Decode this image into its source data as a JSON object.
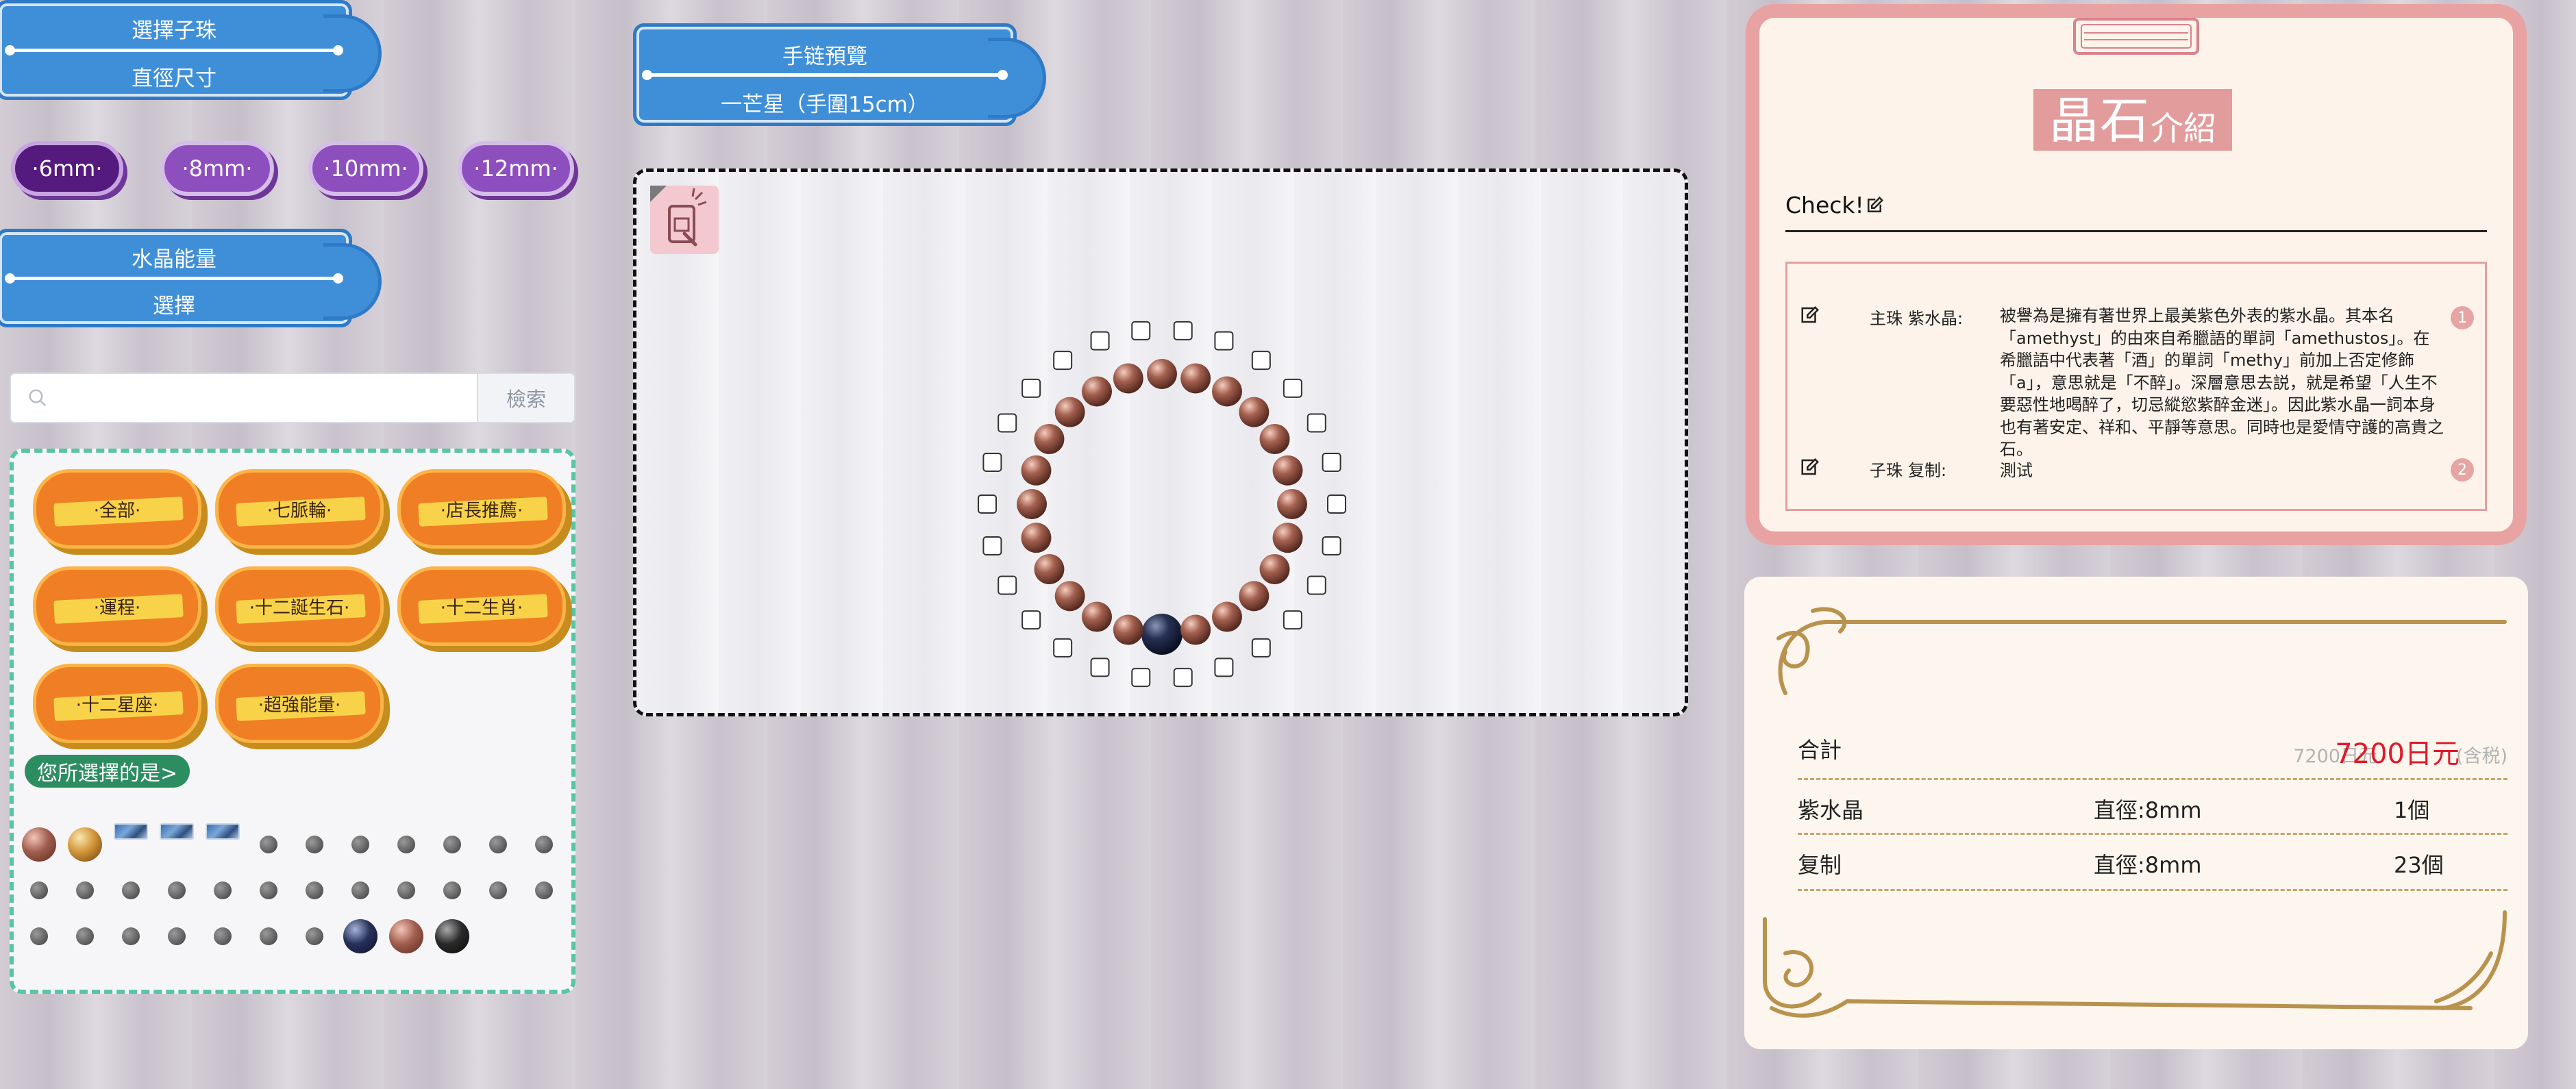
{
  "left": {
    "header_sub": {
      "title": "選擇子珠",
      "sub": "直徑尺寸"
    },
    "sizes": [
      {
        "label": "·6mm·",
        "active": true
      },
      {
        "label": "·8mm·",
        "active": false
      },
      {
        "label": "·10mm·",
        "active": false
      },
      {
        "label": "·12mm·",
        "active": false
      }
    ],
    "header_energy": {
      "title": "水晶能量",
      "sub": "選擇"
    },
    "search": {
      "placeholder": "",
      "button": "檢索"
    },
    "categories": [
      "·全部·",
      "·七脈輪·",
      "·店長推薦·",
      "·運程·",
      "·十二誕生石·",
      "·十二生肖·",
      "·十二星座·",
      "·超強能量·"
    ],
    "selected_label": "您所選擇的是>"
  },
  "preview": {
    "header": {
      "title": "手链預覽",
      "sub": "一芒星（手圍15cm）"
    },
    "qr_icon": "phone-scan-icon"
  },
  "intro": {
    "title_big": "晶石",
    "title_small": "介紹",
    "check_label": "Check!",
    "rows": [
      {
        "role": "主珠",
        "name": "紫水晶:",
        "desc": "被譽為是擁有著世界上最美紫色外表的紫水晶。其本名「amethyst」的由來自希臘語的單詞「amethustos」。在希臘語中代表著「酒」的單詞「methy」前加上否定修飾「a」，意思就是「不醉」。深層意思去説，就是希望「人生不要惡性地喝醉了，切忌縱慾紫醉金迷」。因此紫水晶一詞本身也有著安定、祥和、平靜等意思。同時也是愛情守護的高貴之石。",
        "num": "1"
      },
      {
        "role": "子珠",
        "name": "复制:",
        "desc": "測试",
        "num": "2"
      }
    ]
  },
  "total": {
    "label": "合計",
    "old_price": "7200日元",
    "price": "7200日元",
    "tax": "(含税)",
    "items": [
      {
        "name": "紫水晶",
        "size": "直徑:8mm",
        "qty": "1個"
      },
      {
        "name": "复制",
        "size": "直徑:8mm",
        "qty": "23個"
      }
    ]
  },
  "colors": {
    "ribbon_blue": "#3f8fd8",
    "pill_purple": "#8e4fbe",
    "pill_active": "#551a7d",
    "category_orange": "#f07e25",
    "accent_pink": "#e9a2a2",
    "price_red": "#e0192b",
    "gold": "#b9924d"
  }
}
